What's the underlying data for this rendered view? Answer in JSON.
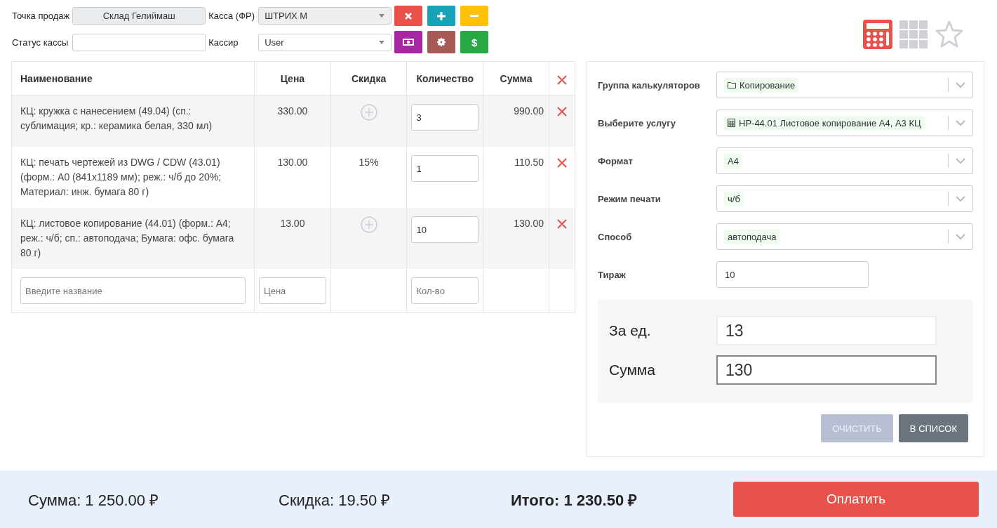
{
  "header": {
    "fields": [
      {
        "label": "Точка продаж",
        "kind": "readonly",
        "value": "Склад Гелиймаш"
      },
      {
        "label": "Касса (ФР)",
        "kind": "select",
        "value": "ШТРИХ М",
        "disabled": true
      },
      {
        "label": "Статус кассы",
        "kind": "input"
      },
      {
        "label": "Кассир",
        "kind": "select",
        "value": "User",
        "disabled": false
      }
    ],
    "buttons": [
      {
        "kind": "close",
        "color": "#e8524a"
      },
      {
        "kind": "plus",
        "color": "#17a2b8"
      },
      {
        "kind": "minus",
        "color": "#ffc107"
      },
      {
        "kind": "cash",
        "color": "#a626a4"
      },
      {
        "kind": "gear",
        "color": "#a85a55"
      },
      {
        "kind": "text",
        "label": "$",
        "color": "#28a745"
      }
    ]
  },
  "view_switch": [
    {
      "kind": "calculator",
      "selected": true
    },
    {
      "kind": "grid",
      "selected": false
    },
    {
      "kind": "star",
      "selected": false
    }
  ],
  "table": {
    "columns": [
      "Наименование",
      "Цена",
      "Скидка",
      "Количество",
      "Сумма"
    ],
    "rows": [
      {
        "name": "КЦ: кружка с нанесением (49.04) (сп.: сублимация; кр.: керамика белая, 330 мл)",
        "price": "330.00",
        "qty": "3",
        "sum": "990.00"
      },
      {
        "name": "КЦ: печать чертежей из DWG / CDW (43.01) (форм.: А0 (841x1189 мм); реж.: ч/б до 20%; Материал: инж. бумага 80 г)",
        "price": "130.00",
        "discount": "15%",
        "qty": "1",
        "sum": "110.50"
      },
      {
        "name": "КЦ: листовое копирование (44.01) (форм.: А4; реж.: ч/б; сп.: автоподача; Бумага: офс. бумага 80 г)",
        "price": "13.00",
        "qty": "10",
        "sum": "130.00"
      }
    ],
    "new_row": {
      "name_placeholder": "Введите название",
      "price_placeholder": "Цена",
      "qty_placeholder": "Кол-во"
    }
  },
  "calculator": {
    "fields": [
      {
        "label": "Группа калькуляторов",
        "kind": "select",
        "value": "Копирование"
      },
      {
        "label": "Выберите услугу",
        "kind": "select",
        "value": "НР-44.01 Листовое копирование А4, А3 КЦ"
      },
      {
        "label": "Формат",
        "kind": "select",
        "value": "А4"
      },
      {
        "label": "Режим печати",
        "kind": "select",
        "value": "ч/б"
      },
      {
        "label": "Способ",
        "kind": "select",
        "value": "автоподача"
      },
      {
        "label": "Тираж",
        "kind": "input",
        "value": "10"
      }
    ],
    "results": [
      {
        "label": "За ед.",
        "value": "13",
        "focused": false
      },
      {
        "label": "Сумма",
        "value": "130",
        "focused": true
      }
    ],
    "buttons": [
      {
        "label": "ОЧИСТИТЬ",
        "disabled": true
      },
      {
        "label": "В СПИСОК",
        "disabled": false
      }
    ]
  },
  "footer": {
    "sum": "Сумма: 1 250.00 ₽",
    "discount": "Скидка: 19.50 ₽",
    "total": "Итого: 1 230.50 ₽",
    "pay_button": "Оплатить"
  }
}
